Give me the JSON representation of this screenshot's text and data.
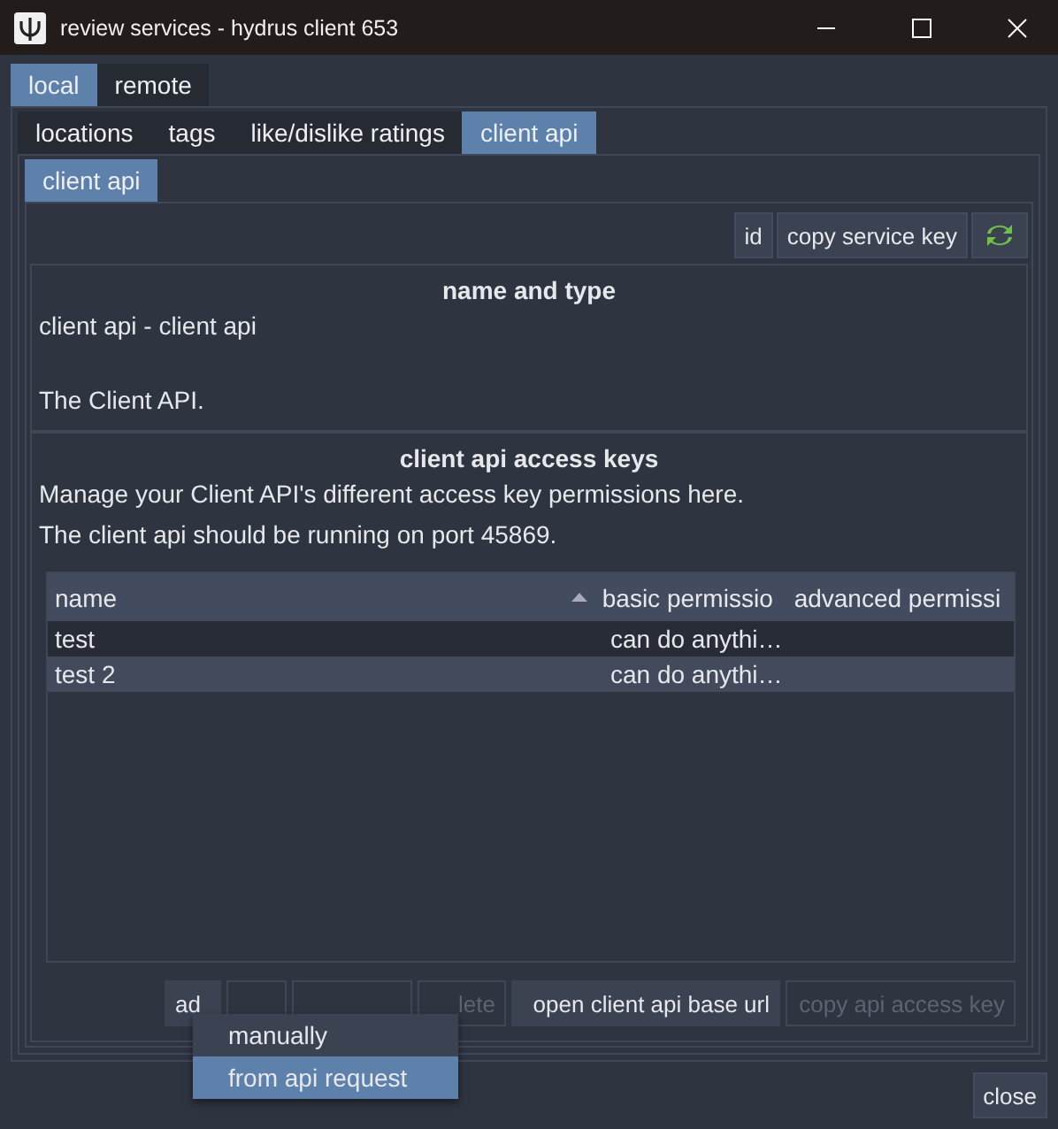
{
  "window": {
    "title": "review services - hydrus client 653"
  },
  "tabs": [
    {
      "label": "local",
      "selected": true
    },
    {
      "label": "remote",
      "selected": false
    }
  ],
  "subtabs": [
    {
      "label": "locations",
      "selected": false
    },
    {
      "label": "tags",
      "selected": false
    },
    {
      "label": "like/dislike ratings",
      "selected": false
    },
    {
      "label": "client api",
      "selected": true
    }
  ],
  "service_tabs": [
    {
      "label": "client api",
      "selected": true
    }
  ],
  "toolbar": [
    {
      "kind": "text",
      "label": "id"
    },
    {
      "kind": "text",
      "label": "copy service key"
    },
    {
      "kind": "refresh"
    }
  ],
  "name_and_type": {
    "title": "name and type",
    "lines": [
      "client api - client api",
      "The Client API."
    ]
  },
  "access_keys": {
    "title": "client api access keys",
    "lines": [
      "Manage your Client API's different access key permissions here.",
      "The client api should be running on port 45869."
    ],
    "table": {
      "columns": [
        {
          "label": "name",
          "sorted": true
        },
        {
          "label": "basic permissio",
          "sorted": false
        },
        {
          "label": "advanced permissi",
          "sorted": false
        }
      ],
      "rows": [
        {
          "cells": [
            "test",
            "can do anythi…"
          ],
          "selected": false
        },
        {
          "cells": [
            "test 2",
            "can do anythi…"
          ],
          "selected": true
        }
      ]
    },
    "buttons": [
      {
        "label": "ad",
        "disabled": false
      },
      {
        "disabled": true
      },
      {
        "disabled": true
      },
      {
        "label": "lete",
        "disabled": true
      },
      {
        "label": "open client api base url",
        "disabled": false
      },
      {
        "label": "copy api access key",
        "disabled": true
      }
    ]
  },
  "menu": [
    {
      "label": "manually",
      "selected": false
    },
    {
      "label": "from api request",
      "selected": true
    }
  ],
  "footer": {
    "button": "close"
  }
}
